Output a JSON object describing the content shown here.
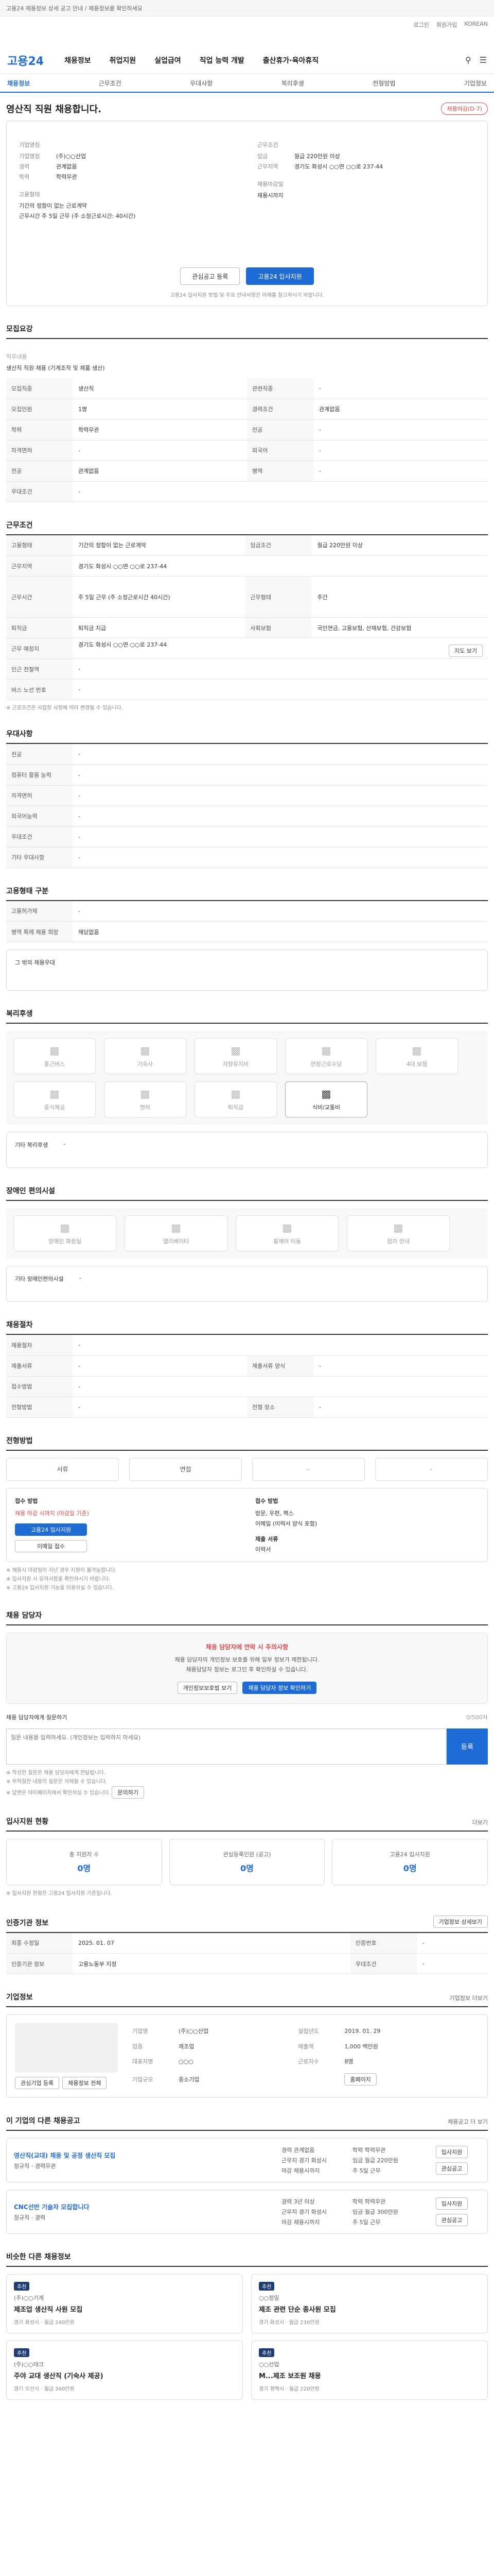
{
  "notice": "고용24 채용정보 상세 공고 안내 / 채용정보를 확인하세요",
  "util": {
    "login": "로그인",
    "join": "회원가입",
    "lang": "KOREAN"
  },
  "brand": "고용24",
  "gnb": [
    "채용정보",
    "취업지원",
    "실업급여",
    "직업 능력 개발",
    "출산휴가·육아휴직"
  ],
  "tabs": [
    "채용정보",
    "근무조건",
    "우대사항",
    "복리후생",
    "전형방법",
    "기업정보"
  ],
  "headline": {
    "title": "영산직 직원 채용합니다.",
    "status": "채용마감(D-7)"
  },
  "summary": {
    "company_label": "기업명칭",
    "company": "(주)○○산업",
    "career_k": "경력",
    "career_v": "관계없음",
    "edu_k": "학력",
    "edu_v": "학력무관",
    "form_k": "고용형태",
    "form_v1": "기간의 정함이 없는 근로계약",
    "form_v2": "근무시간 주 5일 근무 (주 소정근로시간: 40시간)",
    "cond_label": "근무조건",
    "wage_k": "임금",
    "wage_v": "월급 220만원 이상",
    "place_k": "근무지역",
    "place_v": "경기도 화성시 ○○면 ○○로 237-44",
    "deadline_label": "채용마감일",
    "deadline": "채용시까지",
    "btn_scrap": "관심공고 등록",
    "btn_apply": "고용24 입사지원",
    "note": "고용24 입사지원 방법 및 주요 안내사항은 아래를 참고하시기 바랍니다."
  },
  "sec_job": {
    "title": "모집요강",
    "desc_label": "직무내용",
    "desc": "생산직 직원 채용 (기계조작 및 제품 생산)",
    "rows": [
      [
        "모집직종",
        "생산직",
        "관련직종",
        "-"
      ],
      [
        "모집인원",
        "1명",
        "경력조건",
        "관계없음"
      ],
      [
        "학력",
        "학력무관",
        "전공",
        "-"
      ],
      [
        "자격면허",
        "-",
        "외국어",
        "-"
      ],
      [
        "전공",
        "관계없음",
        "병역",
        "-"
      ],
      [
        "우대조건",
        "-",
        "",
        ""
      ]
    ]
  },
  "sec_cond": {
    "title": "근무조건",
    "rows": [
      [
        "고용형태",
        "기간의 정함이 없는 근로계약",
        "임금조건",
        "월급 220만원 이상"
      ],
      [
        "근무지역",
        "경기도 화성시 ○○면 ○○로 237-44",
        "",
        ""
      ],
      [
        "근무시간",
        "주 5일 근무 (주 소정근로시간 40시간)",
        "근무형태",
        "주간"
      ],
      [
        "퇴직금",
        "퇴직금 지급",
        "사회보험",
        "국민연금, 고용보험, 산재보험, 건강보험"
      ],
      [
        "근무 예정지",
        "경기도 화성시 ○○면 ○○로 237-44",
        "",
        ""
      ],
      [
        "인근 전철역",
        "-",
        "",
        ""
      ],
      [
        "버스 노선 번호",
        "-",
        "",
        ""
      ]
    ],
    "map_btn": "지도 보기",
    "note": "※ 근로조건은 사업장 사정에 따라 변경될 수 있습니다."
  },
  "sec_pref": {
    "title": "우대사항",
    "rows": [
      [
        "전공",
        "-"
      ],
      [
        "컴퓨터 활용 능력",
        "-"
      ],
      [
        "자격면허",
        "-"
      ],
      [
        "외국어능력",
        "-"
      ],
      [
        "우대조건",
        "-"
      ],
      [
        "기타 우대사항",
        "-"
      ]
    ]
  },
  "sec_disabled": {
    "title": "고용형태 구분",
    "rows": [
      [
        "고용허가제",
        "-"
      ],
      [
        "병역 특례 채용 희망",
        "해당없음"
      ]
    ],
    "box": "그 밖의 채용우대"
  },
  "sec_welfare": {
    "title": "복리후생",
    "items": [
      {
        "label": "통근버스",
        "on": false
      },
      {
        "label": "기숙사",
        "on": false
      },
      {
        "label": "차량유지비",
        "on": false
      },
      {
        "label": "연장근로수당",
        "on": false
      },
      {
        "label": "4대 보험",
        "on": false
      },
      {
        "label": "중식제공",
        "on": false
      },
      {
        "label": "연차",
        "on": false
      },
      {
        "label": "퇴직금",
        "on": false
      },
      {
        "label": "식비/교통비",
        "on": true
      }
    ],
    "etc_label": "기타 복리후생",
    "etc": "-"
  },
  "sec_facility": {
    "title": "장애인 편의시설",
    "items": [
      "장애인 화장실",
      "엘리베이터",
      "휠체어 이동",
      "점자 안내"
    ],
    "etc_label": "기타 장애인편의시설",
    "etc": "-"
  },
  "sec_extra": {
    "title": "채용절차",
    "rows": [
      [
        "채용절차",
        "-"
      ],
      [
        "제출서류",
        "-",
        "제출서류 양식",
        "-"
      ],
      [
        "접수방법",
        "-",
        "",
        ""
      ],
      [
        "전형방법",
        "-",
        "전형 장소",
        "-"
      ]
    ]
  },
  "sec_screen": {
    "title": "전형방법",
    "steps": [
      "서류",
      "면접",
      "-",
      "-"
    ],
    "apply_head": "접수 방법",
    "apply_v1": "채용 마감 시까지 (마감일 기준)",
    "apply_btn": "고용24 입사지원",
    "apply_btn2": "이메일 접수",
    "doc_head": "접수 방법",
    "doc_v": "방문, 우편, 팩스",
    "doc_v2": "이메일 (이력서 양식 포함)",
    "doc_v3": "제출 서류",
    "doc_v4": "이력서",
    "notes": [
      "※ 채용시 마감일이 지난 경우 지원이 불가능합니다.",
      "※ 입사지원 시 유의사항을 확인하시기 바랍니다.",
      "※ 고용24 입사지원 기능을 이용하실 수 있습니다."
    ]
  },
  "sec_contact": {
    "title": "채용 담당자",
    "alert_t": "채용 담당자에 연락 시 주의사항",
    "alert_p1": "채용 담당자의 개인정보 보호를 위해 일부 정보가 제한됩니다.",
    "alert_p2": "채용담당자 정보는 로그인 후 확인하실 수 있습니다.",
    "btn1": "개인정보보호법 보기",
    "btn2": "채용 담당자 정보 확인하기",
    "qa_label": "채용 담당자에게 질문하기",
    "qa_count": "0/500자",
    "qa_placeholder": "질문 내용을 입력하세요. (개인정보는 입력하지 마세요)",
    "qa_btn": "등록",
    "bullets": [
      "※ 작성한 질문은 채용 담당자에게 전달됩니다.",
      "※ 부적절한 내용의 질문은 삭제될 수 있습니다.",
      "※ 답변은 마이페이지에서 확인하실 수 있습니다."
    ],
    "bullet_btn": "문의하기"
  },
  "sec_stats": {
    "title": "입사지원 현황",
    "more": "더보기",
    "items": [
      {
        "label": "총 지원자 수",
        "num": "0명"
      },
      {
        "label": "관심등록인원 (공고)",
        "num": "0명"
      },
      {
        "label": "고용24 입사지원",
        "num": "0명"
      }
    ],
    "note": "※ 입사지원 현황은 고용24 입사지원 기준입니다."
  },
  "sec_meta": {
    "title": "인증기관 정보",
    "btn": "기업정보 상세보기",
    "rows": [
      [
        "최종 수정일",
        "2025. 01. 07",
        "인증번호",
        "-"
      ],
      [
        "인증기관 정보",
        "고용노동부 지정",
        "우대조건",
        "-"
      ]
    ]
  },
  "sec_corp": {
    "title": "기업정보",
    "more": "기업정보 더보기",
    "btn1": "관심기업 등록",
    "btn2": "채용정보 전체",
    "rows": [
      [
        "기업명",
        "(주)○○산업",
        "설립년도",
        "2019. 01. 29"
      ],
      [
        "업종",
        "제조업",
        "매출액",
        "1,000 백만원"
      ],
      [
        "대표자명",
        "○○○",
        "근로자수",
        "8명"
      ],
      [
        "기업규모",
        "중소기업",
        "",
        ""
      ]
    ],
    "home_btn": "홈페이지"
  },
  "sec_recs": {
    "title": "이 기업의 다른 채용공고",
    "more": "채용공고 더 보기",
    "items": [
      {
        "title": "영산직(교대) 채용 및 공정 생산직 모집",
        "sub": "정규직 · 경력무관",
        "attrs": [
          "경력 관계없음",
          "학력 학력무관",
          "근무지 경기 화성시",
          "임금 월급 220만원",
          "마감 채용시까지",
          "주 5일 근무"
        ],
        "btn1": "입사지원",
        "btn2": "관심공고"
      },
      {
        "title": "CNC선반 기술자 모집합니다",
        "sub": "정규직 · 경력",
        "attrs": [
          "경력 3년 이상",
          "학력 학력무관",
          "근무지 경기 화성시",
          "임금 월급 300만원",
          "마감 채용시까지",
          "주 5일 근무"
        ],
        "btn1": "입사지원",
        "btn2": "관심공고"
      }
    ]
  },
  "sec_similar": {
    "title": "비슷한 다른 채용정보",
    "cards": [
      {
        "badge": "추천",
        "co": "(주)○○기계",
        "title": "제조업 생산직 사원 모집",
        "sm": "경기 화성시 · 월급 240만원"
      },
      {
        "badge": "추천",
        "co": "○○정밀",
        "title": "제조 관련 단순 종사원 모집",
        "sm": "경기 화성시 · 월급 230만원"
      },
      {
        "badge": "추천",
        "co": "(주)○○테크",
        "title": "주야 교대 생산직 (기숙사 제공)",
        "sm": "경기 오산시 · 월급 260만원"
      },
      {
        "badge": "추천",
        "co": "○○산업",
        "title": "M...제조 보조원 채용",
        "sm": "경기 평택시 · 월급 220만원"
      }
    ]
  }
}
